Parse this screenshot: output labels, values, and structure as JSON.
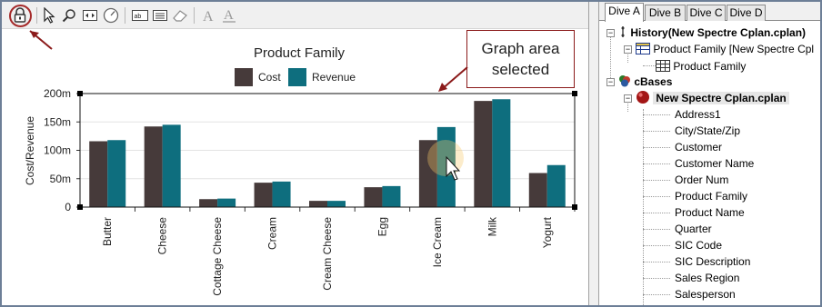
{
  "toolbar": {
    "icons": [
      "lock-icon",
      "pointer-icon",
      "zoom-icon",
      "fit-width-icon",
      "clock-icon",
      "text-label-icon",
      "text-box-icon",
      "eraser-icon",
      "font-icon",
      "font-underline-icon"
    ]
  },
  "callout": {
    "line1": "Graph area",
    "line2": "selected"
  },
  "chart_data": {
    "type": "bar",
    "title": "Product Family",
    "xlabel": "",
    "ylabel": "Cost/Revenue",
    "categories": [
      "Butter",
      "Cheese",
      "Cottage Cheese",
      "Cream",
      "Cream Cheese",
      "Egg",
      "Ice Cream",
      "Milk",
      "Yogurt"
    ],
    "series": [
      {
        "name": "Cost",
        "color": "#463a3a",
        "values": [
          116,
          142,
          14,
          43,
          11,
          35,
          118,
          187,
          60
        ]
      },
      {
        "name": "Revenue",
        "color": "#0e6e7e",
        "values": [
          118,
          145,
          15,
          45,
          11,
          37,
          141,
          190,
          74
        ]
      }
    ],
    "ylim": [
      0,
      200
    ],
    "yticks": [
      0,
      50,
      100,
      150,
      200
    ],
    "ytick_labels": [
      "0",
      "50m",
      "100m",
      "150m",
      "200m"
    ],
    "legend": "top-center",
    "grid": true
  },
  "tabs": [
    "Dive A",
    "Dive B",
    "Dive C",
    "Dive D"
  ],
  "tree": {
    "history": "History(New Spectre Cplan.cplan)",
    "history_child": "Product Family [New Spectre Cpl",
    "history_grandchild": "Product Family",
    "cbases": "cBases",
    "cplan": "New Spectre Cplan.cplan",
    "columns": [
      "Address1",
      "City/State/Zip",
      "Customer",
      "Customer Name",
      "Order Num",
      "Product Family",
      "Product Name",
      "Quarter",
      "SIC Code",
      "SIC Description",
      "Sales Region",
      "Salesperson"
    ]
  }
}
